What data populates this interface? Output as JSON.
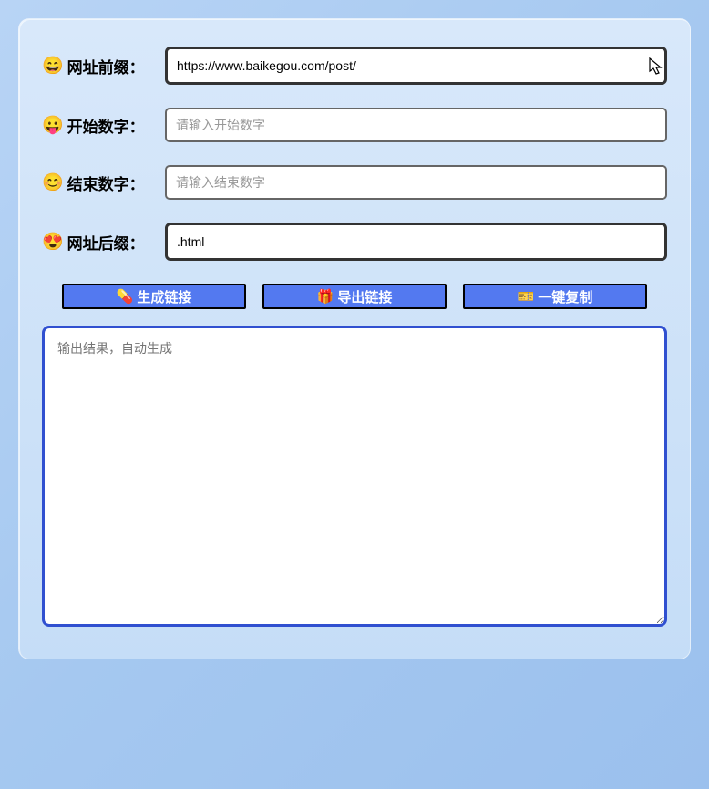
{
  "fields": {
    "prefix": {
      "label": "网址前缀：",
      "emoji": "😄",
      "value": "https://www.baikegou.com/post/",
      "placeholder": ""
    },
    "start": {
      "label": "开始数字：",
      "emoji": "😛",
      "value": "",
      "placeholder": "请输入开始数字"
    },
    "end": {
      "label": "结束数字：",
      "emoji": "😊",
      "value": "",
      "placeholder": "请输入结束数字"
    },
    "suffix": {
      "label": "网址后缀：",
      "emoji": "😍",
      "value": ".html",
      "placeholder": ""
    }
  },
  "buttons": {
    "generate": {
      "label": "生成链接",
      "emoji": "💊"
    },
    "export": {
      "label": "导出链接",
      "emoji": "🎁"
    },
    "copy": {
      "label": "一键复制",
      "emoji": "🎫"
    }
  },
  "output": {
    "placeholder": "输出结果，自动生成"
  }
}
